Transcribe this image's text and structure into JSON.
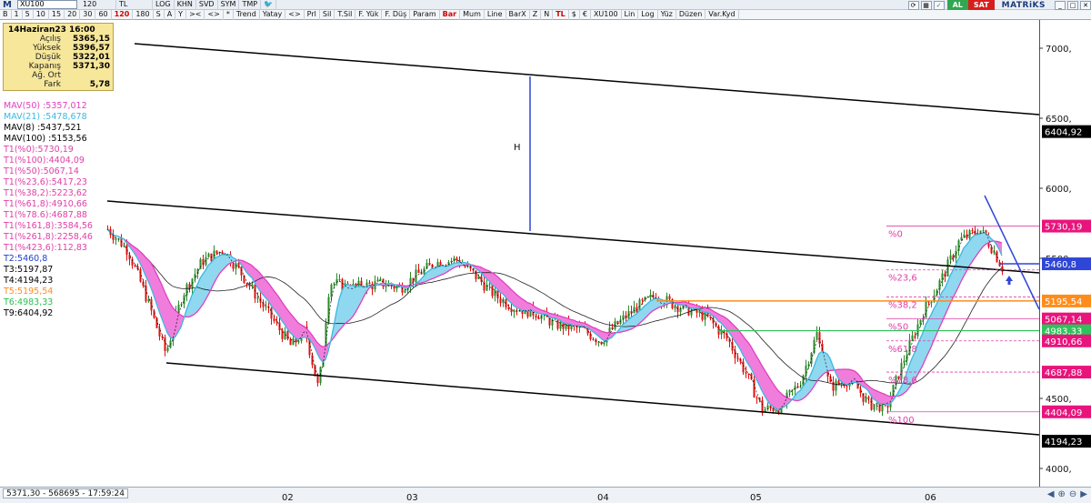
{
  "toolbar": {
    "logo": "M",
    "symbol": "XU100",
    "period": "120",
    "currency": "TL",
    "buttons_row1": [
      "LOG",
      "KHN",
      "SVD",
      "SYM",
      "TMP"
    ],
    "buttons_row2": [
      "B",
      "1",
      "5",
      "10",
      "15",
      "20",
      "30",
      "60",
      "120",
      "180",
      "S",
      "A",
      "Y",
      "><",
      "<>",
      "*",
      "Trend",
      "Yatay",
      "<>",
      "Prl",
      "Sil",
      "T.Sil",
      "F. Yük",
      "F. Düş",
      "Param",
      "Bar",
      "Mum",
      "Line",
      "BarX",
      "Z",
      "N",
      "TL",
      "$",
      "€",
      "XU100",
      "Lin",
      "Log",
      "Yüz",
      "Düzen",
      "Var.Kyd"
    ],
    "active_period": "120",
    "buy_label": "AL",
    "sell_label": "SAT",
    "brand": "MATRiKS"
  },
  "info_box": {
    "date": "14Haziran23 16:00",
    "rows": [
      {
        "label": "Açılış",
        "value": "5365,15"
      },
      {
        "label": "Yüksek",
        "value": "5396,57"
      },
      {
        "label": "Düşük",
        "value": "5322,01"
      },
      {
        "label": "Kapanış",
        "value": "5371,30"
      },
      {
        "label": "Ağ. Ort",
        "value": ""
      },
      {
        "label": "Fark",
        "value": "5,78"
      }
    ]
  },
  "legend": [
    {
      "text": "MAV(50)        :5357,012",
      "color": "#e040c0"
    },
    {
      "text": "MAV(21)        :5478,678",
      "color": "#3bb8e0"
    },
    {
      "text": "MAV(8)         :5437,521",
      "color": "#000000"
    },
    {
      "text": "MAV(100)      :5153,56",
      "color": "#000000"
    },
    {
      "text": "T1(%0):5730,19",
      "color": "#e040a8"
    },
    {
      "text": "T1(%100):4404,09",
      "color": "#e040a8"
    },
    {
      "text": "T1(%50):5067,14",
      "color": "#e040a8"
    },
    {
      "text": "T1(%23,6):5417,23",
      "color": "#e040a8"
    },
    {
      "text": "T1(%38,2):5223,62",
      "color": "#e040a8"
    },
    {
      "text": "T1(%61,8):4910,66",
      "color": "#e040a8"
    },
    {
      "text": "T1(%78.6):4687,88",
      "color": "#e040a8"
    },
    {
      "text": "T1(%161,8):3584,56",
      "color": "#e040a8"
    },
    {
      "text": "T1(%261,8):2258,46",
      "color": "#e040a8"
    },
    {
      "text": "T1(%423,6):112,83",
      "color": "#e040a8"
    },
    {
      "text": "T2:5460,8",
      "color": "#2040d0"
    },
    {
      "text": "T3:5197,87",
      "color": "#000000"
    },
    {
      "text": "T4:4194,23",
      "color": "#000000"
    },
    {
      "text": "T5:5195,54",
      "color": "#ff8c1a"
    },
    {
      "text": "T6:4983,33",
      "color": "#28c050"
    },
    {
      "text": "T9:6404,92",
      "color": "#000000"
    }
  ],
  "y_axis": {
    "min": 3900,
    "max": 7250,
    "ticks": [
      {
        "value": 7000,
        "label": "7000,"
      },
      {
        "value": 6500,
        "label": "6500,"
      },
      {
        "value": 6000,
        "label": "6000,"
      },
      {
        "value": 5500,
        "label": "5500,"
      },
      {
        "value": 4500,
        "label": "4500,"
      },
      {
        "value": 4000,
        "label": "4000,"
      }
    ]
  },
  "price_tags": [
    {
      "value": 6404.92,
      "label": "6404,92",
      "bg": "#000000",
      "fg": "#ffffff"
    },
    {
      "value": 5730.19,
      "label": "5730,19",
      "bg": "#e8147c",
      "fg": "#ffffff"
    },
    {
      "value": 5460.8,
      "label": "5460,8",
      "bg": "#2f46d6",
      "fg": "#ffffff"
    },
    {
      "value": 5195.54,
      "label": "5195,54",
      "bg": "#ff8c1a",
      "fg": "#ffffff"
    },
    {
      "value": 5067.14,
      "label": "5067,14",
      "bg": "#e8147c",
      "fg": "#ffffff"
    },
    {
      "value": 4983.33,
      "label": "4983,33",
      "bg": "#2ec25a",
      "fg": "#ffffff"
    },
    {
      "value": 4910.66,
      "label": "4910,66",
      "bg": "#e8147c",
      "fg": "#ffffff"
    },
    {
      "value": 4687.88,
      "label": "4687,88",
      "bg": "#e8147c",
      "fg": "#ffffff"
    },
    {
      "value": 4404.09,
      "label": "4404,09",
      "bg": "#e8147c",
      "fg": "#ffffff"
    },
    {
      "value": 4194.23,
      "label": "4194,23",
      "bg": "#000000",
      "fg": "#ffffff"
    }
  ],
  "fib_labels": [
    {
      "value": 5730.19,
      "label": "%0"
    },
    {
      "value": 5417.23,
      "label": "%23,6"
    },
    {
      "value": 5223.62,
      "label": "%38,2"
    },
    {
      "value": 5067.14,
      "label": "%50"
    },
    {
      "value": 4910.66,
      "label": "%61,8"
    },
    {
      "value": 4687.88,
      "label": "%78,6"
    },
    {
      "value": 4404.09,
      "label": "%100"
    }
  ],
  "h_marker": "H",
  "x_axis_labels": [
    "02",
    "03",
    "04",
    "05",
    "06"
  ],
  "status": {
    "text": "5371,30 - 568695 - 17:59:24"
  },
  "colors": {
    "bull": "#2a8a2a",
    "bear": "#e01010",
    "mav50": "#e040c0",
    "mav21": "#3bb8e0",
    "ribbon_fill_up": "#8fd8ef",
    "ribbon_fill_down": "#f07ddc",
    "trend": "#000000",
    "fib": "#e040a8",
    "blue": "#2f46d6",
    "orange": "#ff8c1a",
    "green": "#2ec25a"
  }
}
